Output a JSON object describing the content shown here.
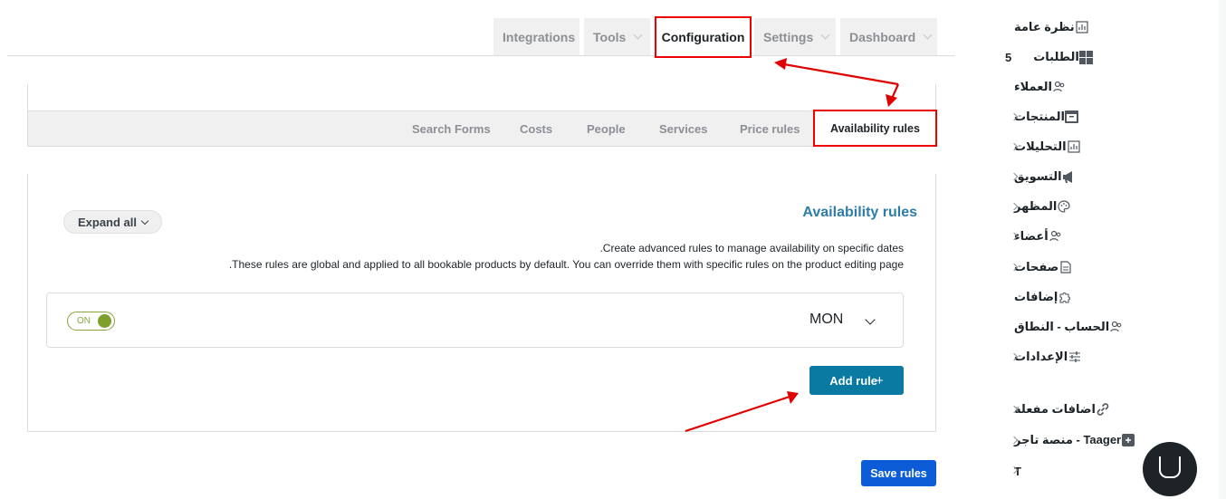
{
  "top_tabs": {
    "integrations": "Integrations",
    "tools": "Tools",
    "configuration": "Configuration",
    "settings": "Settings",
    "dashboard": "Dashboard"
  },
  "sub_tabs": {
    "search_forms": "Search Forms",
    "costs": "Costs",
    "people": "People",
    "services": "Services",
    "price_rules": "Price rules",
    "availability_rules": "Availability rules"
  },
  "main": {
    "title": "Availability rules",
    "desc_line1": ".Create advanced rules to manage availability on specific dates",
    "desc_line2": ".These rules are global and applied to all bookable products by default. You can override them with specific rules on the product editing page",
    "expand_all": "Expand all",
    "rule": {
      "toggle_label": "ON",
      "day": "MON"
    },
    "add_rule": "Add rule",
    "save_rules": "Save rules"
  },
  "sidebar": {
    "items": [
      {
        "label": "نظرة عامة",
        "icon": "chart-icon"
      },
      {
        "label": "الطلبات",
        "count": "5",
        "icon": "grid-icon"
      },
      {
        "label": "العملاء",
        "icon": "users-icon"
      },
      {
        "label": "المنتجات",
        "icon": "box-icon"
      },
      {
        "label": "التحليلات",
        "icon": "chart-icon"
      },
      {
        "label": "التسويق",
        "icon": "megaphone-icon"
      },
      {
        "label": "المظهر",
        "icon": "palette-icon"
      },
      {
        "label": "أعضاء",
        "icon": "users-icon"
      },
      {
        "label": "صفحات",
        "icon": "page-icon"
      },
      {
        "label": "إضافات",
        "icon": "puzzle-icon"
      },
      {
        "label": "الحساب - النطاق",
        "icon": "users-icon"
      },
      {
        "label": "الإعدادات",
        "icon": "sliders-icon"
      },
      {
        "label": "اضافات مفعلة",
        "icon": "link-icon"
      },
      {
        "label": "Taager - منصة تاجر",
        "icon": "taager-icon"
      },
      {
        "label": "T",
        "icon": ""
      }
    ]
  },
  "colors": {
    "accent": "#0a7aa3",
    "save_button": "#0b5cd6",
    "highlight_red": "#e00000",
    "toggle_green": "#7d9f2c",
    "title_blue": "#2d7da8"
  }
}
